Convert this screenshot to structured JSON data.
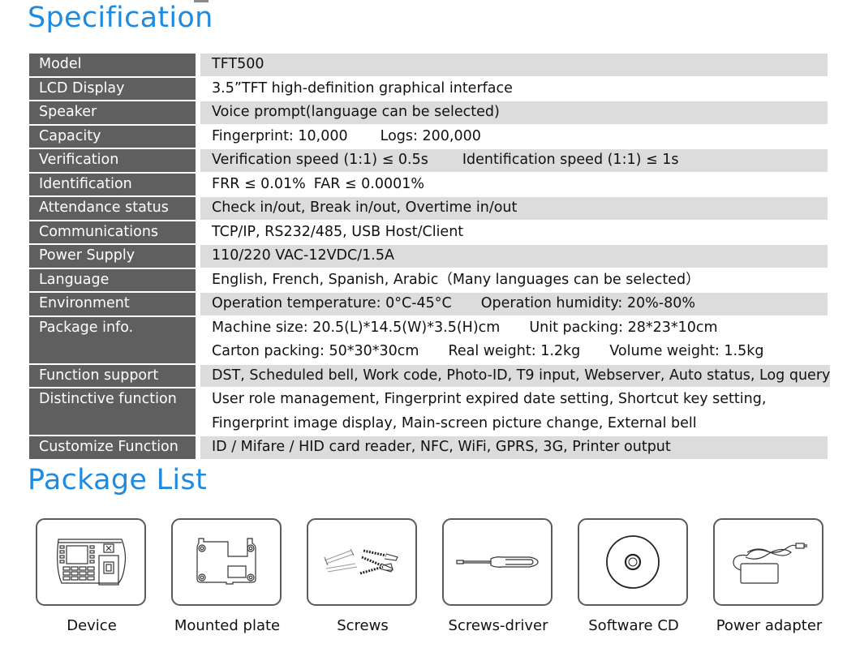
{
  "specification": {
    "title": "Specification",
    "rows": [
      {
        "label": "Model",
        "values": [
          "TFT500"
        ],
        "shaded": true
      },
      {
        "label": "LCD Display",
        "values": [
          "3.5”TFT high-definition graphical interface"
        ],
        "shaded": false
      },
      {
        "label": "Speaker",
        "values": [
          "Voice prompt(language can be selected)"
        ],
        "shaded": true
      },
      {
        "label": "Capacity",
        "values": [
          "Fingerprint: 10,000",
          "Logs: 200,000"
        ],
        "shaded": false
      },
      {
        "label": "Verification",
        "values": [
          "Verification speed (1:1) ≤ 0.5s",
          "Identification speed (1:1) ≤ 1s"
        ],
        "shaded": true
      },
      {
        "label": "Identification",
        "values": [
          "FRR ≤ 0.01%",
          "FAR ≤ 0.0001%"
        ],
        "shaded": false
      },
      {
        "label": "Attendance status",
        "values": [
          "Check in/out, Break in/out, Overtime in/out"
        ],
        "shaded": true
      },
      {
        "label": "Communications",
        "values": [
          "TCP/IP, RS232/485, USB Host/Client"
        ],
        "shaded": false
      },
      {
        "label": "Power Supply",
        "values": [
          "110/220 VAC-12VDC/1.5A"
        ],
        "shaded": true
      },
      {
        "label": "Language",
        "values": [
          "English, French, Spanish, Arabic（Many languages can be selected）"
        ],
        "shaded": false
      },
      {
        "label": "Environment",
        "values": [
          "Operation temperature: 0°C-45°C",
          "Operation humidity: 20%-80%"
        ],
        "shaded": true
      },
      {
        "label": "Package info.",
        "values": [
          "Machine size: 20.5(L)*14.5(W)*3.5(H)cm",
          "Unit packing: 28*23*10cm",
          "Carton packing: 50*30*30cm",
          "Real weight: 1.2kg",
          "Volume weight: 1.5kg"
        ],
        "shaded": false
      },
      {
        "label": "Function support",
        "values": [
          "DST, Scheduled bell, Work code, Photo-ID, T9 input, Webserver, Auto status, Log query"
        ],
        "shaded": true
      },
      {
        "label": "Distinctive function",
        "values": [
          "User role management, Fingerprint expired date setting, Shortcut key setting,",
          "Fingerprint image display, Main-screen picture change, External bell"
        ],
        "shaded": false
      },
      {
        "label": "Customize Function",
        "values": [
          "ID / Mifare / HID card reader, NFC, WiFi, GPRS, 3G, Printer output"
        ],
        "shaded": true
      }
    ]
  },
  "package_list": {
    "title": "Package List",
    "items": [
      {
        "label": "Device",
        "icon": "fingerprint-terminal-icon"
      },
      {
        "label": "Mounted plate",
        "icon": "mounting-plate-icon"
      },
      {
        "label": "Screws",
        "icon": "screws-icon"
      },
      {
        "label": "Screws-driver",
        "icon": "screwdriver-icon"
      },
      {
        "label": "Software CD",
        "icon": "cd-icon"
      },
      {
        "label": "Power adapter",
        "icon": "power-adapter-icon"
      }
    ]
  },
  "colors": {
    "title_blue": "#1f8be0",
    "label_bg": "#5f5f5f",
    "shaded_row_bg": "#dcdcdc"
  }
}
